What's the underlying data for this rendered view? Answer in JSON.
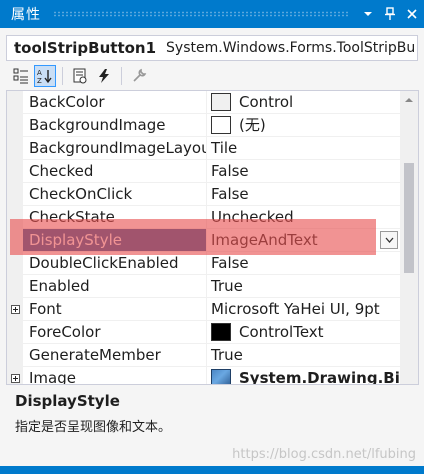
{
  "titlebar": {
    "title": "属性",
    "dropdown_glyph": "▾",
    "pin_glyph": "📌",
    "close_glyph": "✕"
  },
  "object_selector": {
    "name": "toolStripButton1",
    "type": "System.Windows.Forms.ToolStripBu"
  },
  "toolbar": {
    "buttons": [
      "categorized-icon",
      "alphabetical-icon",
      "properties-icon",
      "events-icon",
      "property-pages-icon"
    ],
    "active": "alphabetical-icon"
  },
  "properties": [
    {
      "name": "BackColor",
      "value": "Control",
      "swatch": "#f0f0f0"
    },
    {
      "name": "BackgroundImage",
      "value": "(无)",
      "swatch": "#ffffff"
    },
    {
      "name": "BackgroundImageLayout",
      "value": "Tile"
    },
    {
      "name": "Checked",
      "value": "False"
    },
    {
      "name": "CheckOnClick",
      "value": "False"
    },
    {
      "name": "CheckState",
      "value": "Unchecked"
    },
    {
      "name": "DisplayStyle",
      "value": "ImageAndText",
      "selected": true
    },
    {
      "name": "DoubleClickEnabled",
      "value": "False"
    },
    {
      "name": "Enabled",
      "value": "True"
    },
    {
      "name": "Font",
      "value": "Microsoft YaHei UI, 9pt",
      "expandable": true
    },
    {
      "name": "ForeColor",
      "value": "ControlText",
      "swatch": "#000000"
    },
    {
      "name": "GenerateMember",
      "value": "True"
    },
    {
      "name": "Image",
      "value": "System.Drawing.Bitm",
      "expandable": true,
      "image": true
    }
  ],
  "description": {
    "title": "DisplayStyle",
    "text": "指定是否呈现图像和文本。"
  },
  "watermark": "https://blog.csdn.net/lfubing",
  "colors": {
    "accent": "#007acc",
    "selection": "#2d5a9c",
    "highlight": "#e85050"
  }
}
